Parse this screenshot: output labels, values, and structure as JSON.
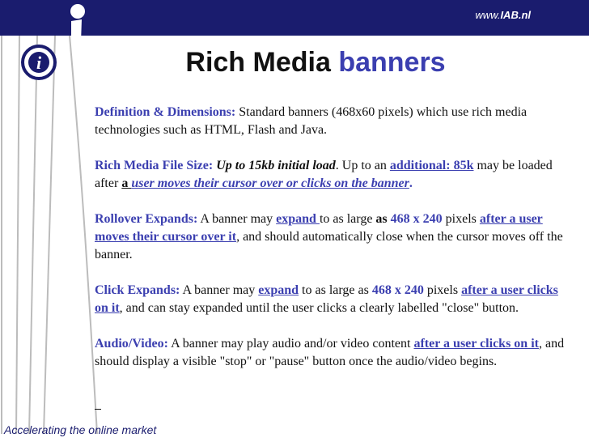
{
  "header": {
    "url_prefix": "www.",
    "url_domain": "IAB.nl"
  },
  "logo": {
    "glyph": "i"
  },
  "title": {
    "main": "Rich Media",
    "accent": "banners"
  },
  "definition": {
    "label": "Definition & Dimensions:",
    "text": " Standard banners (468x60 pixels) which use rich media technologies such as HTML, Flash and Java."
  },
  "filesize": {
    "label": "Rich Media File Size:",
    "initial": "Up to 15kb initial load",
    "t1": ". Up to an ",
    "additional": "additional: 85k",
    "t2": " may be loaded after ",
    "after_a": "a ",
    "cursor_text": "user moves their cursor over or clicks on the banner",
    "end": "."
  },
  "rollover": {
    "label": "Rollover Expands:",
    "t1": " A banner may ",
    "expand": "expand ",
    "t2": "to as large ",
    "as": "as",
    "size": " 468 x 240",
    "t3": " pixels ",
    "after": "after a user moves their cursor over it",
    "t4": ", and should automatically close when the cursor moves off the banner."
  },
  "click": {
    "label": "Click Expands:",
    "t1": " A banner may ",
    "expand": "expand",
    "t2": " to as large as ",
    "size": "468 x 240",
    "t3": " pixels ",
    "after": "after a user clicks on it",
    "t4": ", and can stay expanded until the user clicks a clearly labelled \"close\" button."
  },
  "audio": {
    "label": "Audio/Video:",
    "t1": " A banner may play audio and/or video content ",
    "after": "after a user clicks on it",
    "t2": ", and should display a visible \"stop\" or \"pause\" button once the audio/video begins."
  },
  "footer": {
    "tagline": "Accelerating the online market"
  },
  "colors": {
    "navy": "#1a1c6e",
    "accent": "#3b3fb0",
    "text": "#111111",
    "stripe": "#bcbcbc"
  }
}
